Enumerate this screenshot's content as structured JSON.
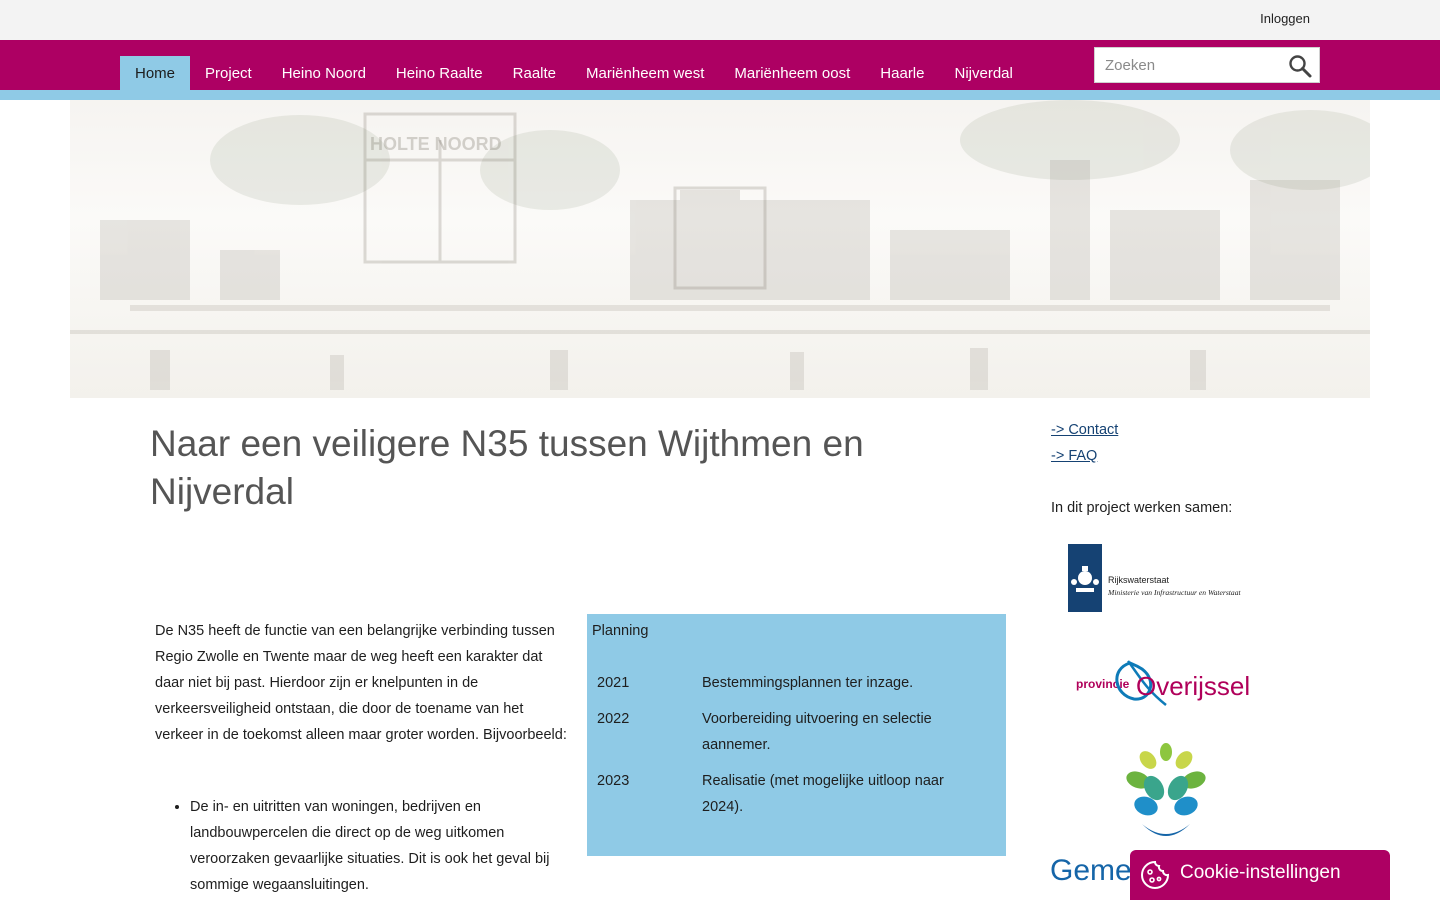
{
  "topbar": {
    "login_label": "Inloggen"
  },
  "nav": {
    "items": [
      {
        "label": "Home",
        "active": true
      },
      {
        "label": "Project",
        "active": false
      },
      {
        "label": "Heino Noord",
        "active": false
      },
      {
        "label": "Heino Raalte",
        "active": false
      },
      {
        "label": "Raalte",
        "active": false
      },
      {
        "label": "Mariënheem west",
        "active": false
      },
      {
        "label": "Mariënheem oost",
        "active": false
      },
      {
        "label": "Haarle",
        "active": false
      },
      {
        "label": "Nijverdal",
        "active": false
      }
    ],
    "search_placeholder": "Zoeken",
    "search_icon": "search-icon"
  },
  "hero": {
    "sign_text": "HOLTE NOORD"
  },
  "main": {
    "title": "Naar een veiligere N35 tussen Wijthmen en Nijverdal",
    "intro": "De N35 heeft de functie van een belangrijke verbinding tussen Regio Zwolle en Twente maar de weg heeft een karakter dat daar niet bij past. Hierdoor zijn er knelpunten in de verkeersveiligheid ontstaan, die door de toename van het verkeer in de toekomst alleen maar groter worden. Bijvoorbeeld:",
    "bullets": [
      "De in- en uitritten van woningen, bedrijven en landbouwpercelen die direct op de weg uitkomen veroorzaken gevaarlijke situaties. Dit is ook het geval bij sommige wegaansluitingen."
    ]
  },
  "planning": {
    "title": "Planning",
    "rows": [
      {
        "year": "2021",
        "text": "Bestemmingsplannen ter inzage."
      },
      {
        "year": "2022",
        "text": "Voorbereiding uitvoering en selectie aannemer."
      },
      {
        "year": "2023",
        "text": "Realisatie (met mogelijke uitloop naar 2024)."
      }
    ]
  },
  "sidebar": {
    "links": [
      "-> Contact",
      "-> FAQ"
    ],
    "partners_heading": "In dit project werken samen:",
    "logos": {
      "rws_line1": "Rijkswaterstaat",
      "rws_line2": "Ministerie van Infrastructuur en Waterstaat",
      "ov_prefix": "provincie",
      "ov_name": "Overijssel",
      "gem_text": "Geme"
    }
  },
  "cookie": {
    "label": "Cookie-instellingen",
    "icon": "cookie-icon"
  },
  "colors": {
    "brand": "#ad0063",
    "accent_blue": "#8fcae6",
    "link": "#154273",
    "title_gray": "#555555"
  }
}
